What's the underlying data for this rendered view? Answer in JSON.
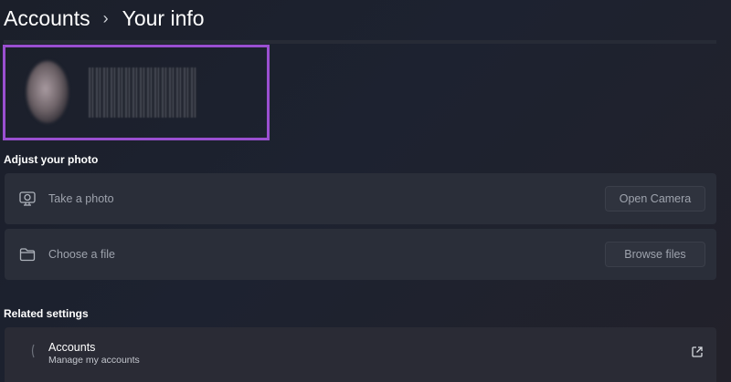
{
  "breadcrumb": {
    "parent": "Accounts",
    "separator": "›",
    "current": "Your info"
  },
  "adjust_photo": {
    "heading": "Adjust your photo",
    "take_photo": {
      "label": "Take a photo",
      "icon": "camera-icon",
      "button": "Open Camera"
    },
    "choose_file": {
      "label": "Choose a file",
      "icon": "folder-icon",
      "button": "Browse files"
    }
  },
  "related_settings": {
    "heading": "Related settings",
    "accounts": {
      "title": "Accounts",
      "subtitle": "Manage my accounts",
      "icon": "external-link-icon"
    }
  },
  "colors": {
    "highlight": "#9a4fd0",
    "card": "#2a2e39",
    "background": "#1d2230"
  }
}
